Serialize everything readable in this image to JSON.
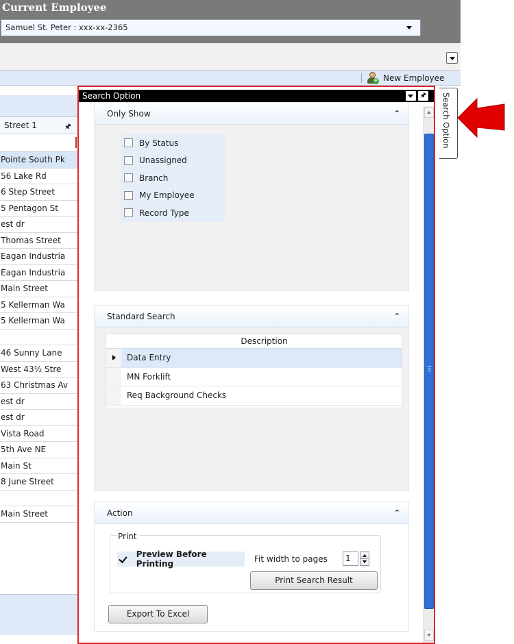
{
  "header": {
    "title": "Current Employee",
    "employee_select": "Samuel  St. Peter : xxx-xx-2365"
  },
  "toolbar": {
    "new_employee_label": "New Employee"
  },
  "grid": {
    "column_header": "Street 1",
    "rows": [
      "Pointe South Pk",
      "56 Lake Rd",
      "6 Step Street",
      "5 Pentagon St",
      "est dr",
      "Thomas Street",
      " Eagan Industria",
      " Eagan Industria",
      " Main Street",
      "5 Kellerman Wa",
      "5 Kellerman Wa",
      "",
      "46 Sunny Lane",
      " West 43½ Stre",
      "63 Christmas Av",
      "est dr",
      "est dr",
      " Vista Road",
      " 5th Ave NE",
      "Main St",
      "8 June Street",
      "",
      " Main Street"
    ]
  },
  "search_panel": {
    "title": "Search Option",
    "side_tab_label": "Search Option",
    "only_show": {
      "title": "Only Show",
      "options": [
        "By Status",
        "Unassigned",
        "Branch",
        "My Employee",
        "Record Type"
      ]
    },
    "standard_search": {
      "title": "Standard Search",
      "column": "Description",
      "rows": [
        "Data Entry",
        "MN Forklift",
        "Req Background Checks"
      ]
    },
    "action": {
      "title": "Action",
      "print_group": "Print",
      "preview_label": "Preview Before Printing",
      "preview_checked": true,
      "fit_label": "Fit width to pages",
      "fit_value": "1",
      "print_button": "Print Search Result",
      "export_button": "Export To Excel"
    }
  },
  "colors": {
    "highlight_frame": "#e2242b",
    "arrow": "#e00000",
    "scroll_thumb": "#2f6fd8"
  }
}
